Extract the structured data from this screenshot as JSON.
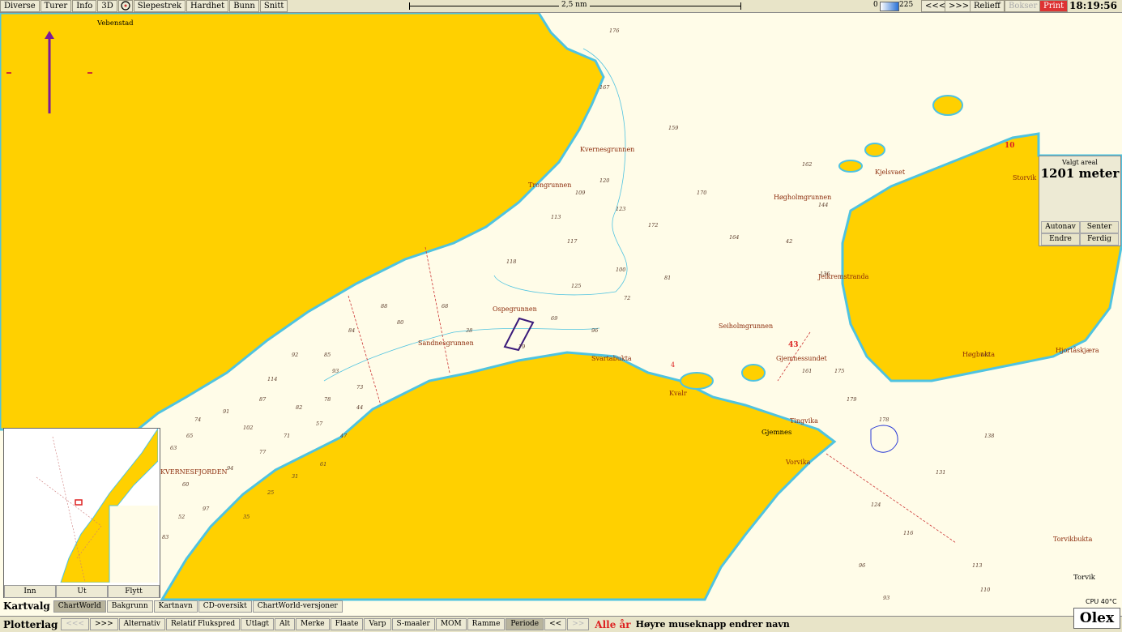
{
  "toolbar": {
    "items": [
      "Diverse",
      "Turer",
      "Info",
      "3D",
      "Slepestrek",
      "Hardhet",
      "Bunn",
      "Snitt"
    ],
    "scale": "2,5 nm",
    "depth_min": "0",
    "depth_max": "225",
    "back": "<<<",
    "forward": ">>>",
    "relief": "Relieff",
    "boxes": "Bokser",
    "print": "Print",
    "time": "18:19:56"
  },
  "panel": {
    "title": "Valgt areal",
    "value": "1201 meter",
    "autonav": "Autonav",
    "center": "Senter",
    "change": "Endre",
    "done": "Ferdig"
  },
  "minimap": {
    "zoom_in": "Inn",
    "zoom_out": "Ut",
    "move": "Flytt"
  },
  "kartvalg": {
    "label": "Kartvalg",
    "items": [
      "ChartWorld",
      "Bakgrunn",
      "Kartnavn",
      "CD-oversikt",
      "ChartWorld-versjoner"
    ]
  },
  "plotterlag": {
    "label": "Plotterlag",
    "back": "<<<",
    "forward": ">>>",
    "items": [
      "Alternativ",
      "Relatif Flukspred",
      "Utlagt",
      "Alt",
      "Merke",
      "Flaate",
      "Varp",
      "S-maaler",
      "MOM",
      "Ramme",
      "Periode"
    ],
    "prev": "<<",
    "next": ">>",
    "all_years": "Alle år",
    "hint": "Høyre museknapp endrer navn"
  },
  "status": {
    "cpu": "CPU 40°C",
    "logo": "Olex"
  },
  "places": {
    "vebenstad": "Vebenstad",
    "kvernesgrunnen": "Kvernesgrunnen",
    "trongrunnen": "Trongrunnen",
    "ospegrunnen": "Ospegrunnen",
    "sandnesgrunnen": "Sandnesgrunnen",
    "svartabukta": "Svartabukta",
    "seiholmgrunnen": "Seiholmgrunnen",
    "hogholmgrunnen": "Høgholmgrunnen",
    "kjelsvaet": "Kjelsvaet",
    "jelkremstranda": "Jelkremstranda",
    "gjemnessundet": "Gjemnessundet",
    "gjemnes": "Gjemnes",
    "tingvika": "Tingvika",
    "vorvika": "Vorvika",
    "hogbukta": "Høgbukta",
    "hjortaskjaera": "Hjortåskjæra",
    "storvik": "Storvik",
    "torvikbukta": "Torvikbukta",
    "torvik": "Torvik",
    "kvernesfjorden": "KVERNESFJORDEN",
    "kvalr": "Kvalr"
  },
  "depths": [
    "176",
    "167",
    "159",
    "170",
    "164",
    "172",
    "123",
    "109",
    "117",
    "118",
    "113",
    "120",
    "125",
    "100",
    "81",
    "72",
    "69",
    "96",
    "79",
    "38",
    "68",
    "80",
    "88",
    "84",
    "85",
    "92",
    "114",
    "93",
    "73",
    "78",
    "82",
    "87",
    "102",
    "91",
    "74",
    "65",
    "63",
    "60",
    "52",
    "83",
    "97",
    "94",
    "77",
    "71",
    "57",
    "47",
    "44",
    "61",
    "31",
    "25",
    "35",
    "42",
    "162",
    "144",
    "136",
    "161",
    "175",
    "179",
    "178",
    "142",
    "138",
    "131",
    "124",
    "116",
    "113",
    "110",
    "96",
    "93"
  ],
  "marks": {
    "m10": "10",
    "m43": "43",
    "m4": "4"
  }
}
